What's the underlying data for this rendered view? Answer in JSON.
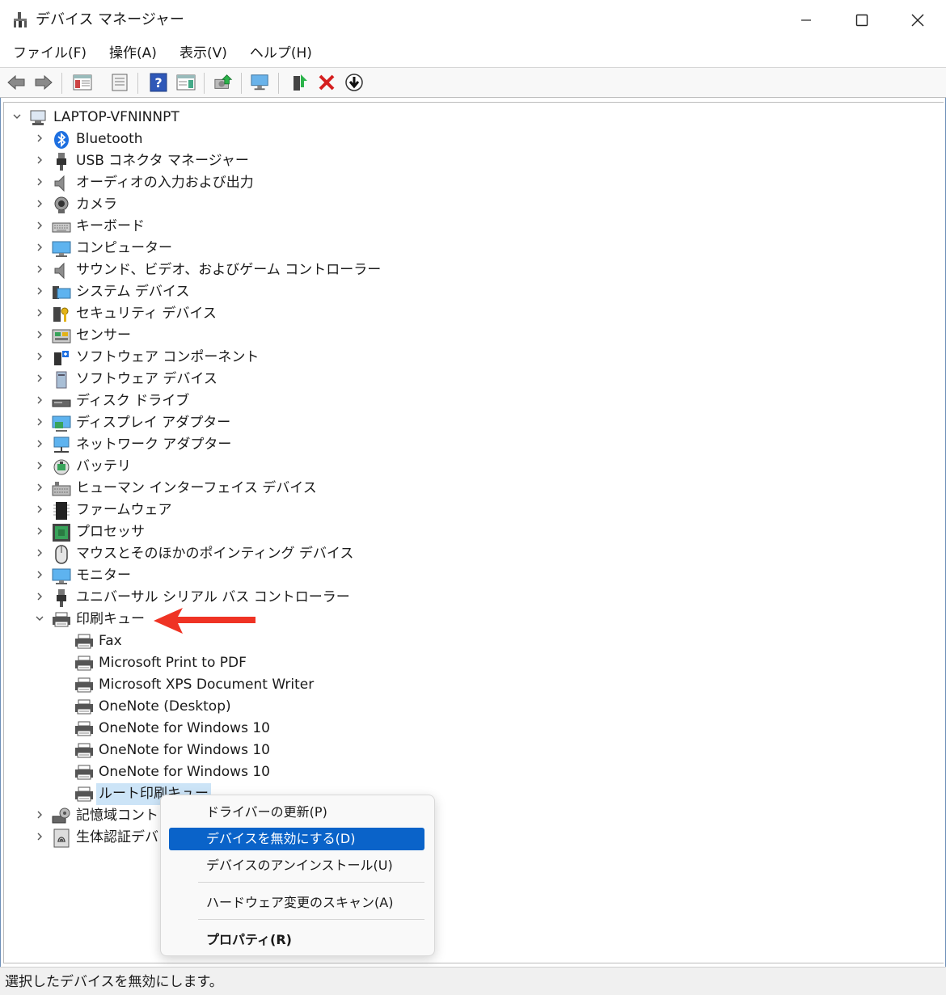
{
  "window": {
    "title": "デバイス マネージャー"
  },
  "menu": [
    "ファイル(F)",
    "操作(A)",
    "表示(V)",
    "ヘルプ(H)"
  ],
  "tree": {
    "root": "LAPTOP-VFNINNPT",
    "categories": [
      {
        "label": "Bluetooth",
        "icon": "bluetooth-icon"
      },
      {
        "label": "USB コネクタ マネージャー",
        "icon": "usb-connector-icon"
      },
      {
        "label": "オーディオの入力および出力",
        "icon": "speaker-icon"
      },
      {
        "label": "カメラ",
        "icon": "camera-icon"
      },
      {
        "label": "キーボード",
        "icon": "keyboard-icon"
      },
      {
        "label": "コンピューター",
        "icon": "computer-icon"
      },
      {
        "label": "サウンド、ビデオ、およびゲーム コントローラー",
        "icon": "speaker-icon"
      },
      {
        "label": "システム デバイス",
        "icon": "system-device-icon"
      },
      {
        "label": "セキュリティ デバイス",
        "icon": "security-key-icon"
      },
      {
        "label": "センサー",
        "icon": "sensor-icon"
      },
      {
        "label": "ソフトウェア コンポーネント",
        "icon": "software-component-icon"
      },
      {
        "label": "ソフトウェア デバイス",
        "icon": "software-device-icon"
      },
      {
        "label": "ディスク ドライブ",
        "icon": "disk-drive-icon"
      },
      {
        "label": "ディスプレイ アダプター",
        "icon": "display-adapter-icon"
      },
      {
        "label": "ネットワーク アダプター",
        "icon": "network-adapter-icon"
      },
      {
        "label": "バッテリ",
        "icon": "battery-icon"
      },
      {
        "label": "ヒューマン インターフェイス デバイス",
        "icon": "hid-icon"
      },
      {
        "label": "ファームウェア",
        "icon": "firmware-chip-icon"
      },
      {
        "label": "プロセッサ",
        "icon": "processor-icon"
      },
      {
        "label": "マウスとそのほかのポインティング デバイス",
        "icon": "mouse-icon"
      },
      {
        "label": "モニター",
        "icon": "monitor-icon"
      },
      {
        "label": "ユニバーサル シリアル バス コントローラー",
        "icon": "usb-connector-icon"
      }
    ],
    "print_queue": {
      "label": "印刷キュー",
      "children": [
        "Fax",
        "Microsoft Print to PDF",
        "Microsoft XPS Document Writer",
        "OneNote (Desktop)",
        "OneNote for Windows 10",
        "OneNote for Windows 10",
        "OneNote for Windows 10",
        "ルート印刷キュー"
      ]
    },
    "after": [
      {
        "label": "記憶域コントローラー",
        "visible": "記憶域コントロ",
        "icon": "storage-controller-icon"
      },
      {
        "label": "生体認証デバイス",
        "visible": "生体認証デバ",
        "icon": "fingerprint-icon"
      }
    ]
  },
  "context_menu": {
    "update_driver": "ドライバーの更新(P)",
    "disable_device": "デバイスを無効にする(D)",
    "uninstall_device": "デバイスのアンインストール(U)",
    "scan_hardware": "ハードウェア変更のスキャン(A)",
    "properties": "プロパティ(R)"
  },
  "status": {
    "text": "選択したデバイスを無効にします。"
  },
  "colors": {
    "highlight": "#0a63c9",
    "selection": "#cce4f7",
    "annotation_arrow": "#ee2211"
  }
}
